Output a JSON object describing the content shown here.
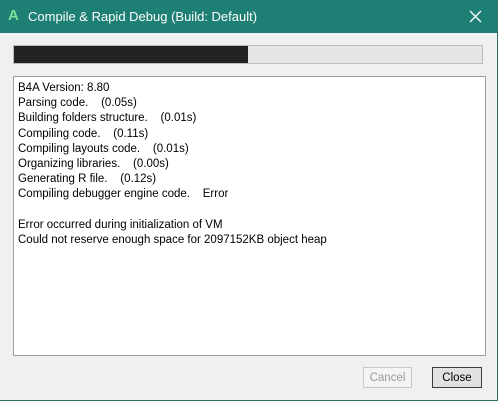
{
  "window": {
    "title": "Compile & Rapid Debug (Build: Default)",
    "app_icon_glyph": "A",
    "accent_color": "#1e7f74"
  },
  "progress": {
    "value_fraction": 0.5
  },
  "log": {
    "lines": [
      "B4A Version: 8.80",
      "Parsing code.    (0.05s)",
      "Building folders structure.    (0.01s)",
      "Compiling code.    (0.11s)",
      "Compiling layouts code.    (0.01s)",
      "Organizing libraries.    (0.00s)",
      "Generating R file.    (0.12s)",
      "Compiling debugger engine code.    Error",
      "",
      "Error occurred during initialization of VM",
      "Could not reserve enough space for 2097152KB object heap"
    ]
  },
  "buttons": {
    "cancel_label": "Cancel",
    "close_label": "Close"
  }
}
